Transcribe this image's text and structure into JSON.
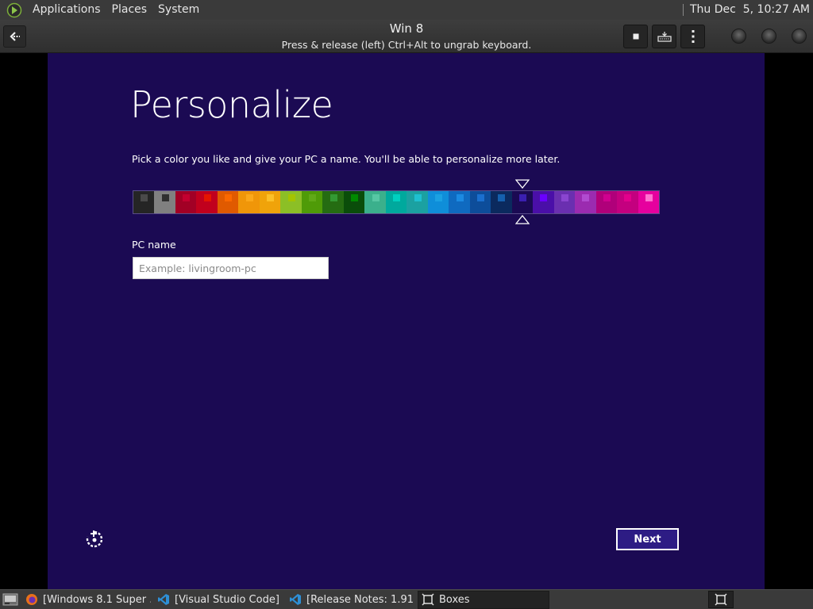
{
  "top_panel": {
    "menus": [
      "Applications",
      "Places",
      "System"
    ],
    "clock": "Thu Dec  5, 10:27 AM"
  },
  "header": {
    "title": "Win 8",
    "subtitle": "Press & release (left) Ctrl+Alt to ungrab keyboard."
  },
  "vm": {
    "title": "Personalize",
    "description": "Pick a color you like and give your PC a name. You'll be able to personalize more later.",
    "pc_name_label": "PC name",
    "pc_name_value": "",
    "pc_name_placeholder": "Example: livingroom-pc",
    "next_label": "Next",
    "selected_color_index": 18,
    "colors": [
      {
        "bg": "#252525",
        "chip": "#4a4a4a"
      },
      {
        "bg": "#808080",
        "chip": "#303030"
      },
      {
        "bg": "#a20025",
        "chip": "#c3002f"
      },
      {
        "bg": "#c1001d",
        "chip": "#e51400"
      },
      {
        "bg": "#e05a00",
        "chip": "#fa6800"
      },
      {
        "bg": "#f09609",
        "chip": "#fba81a"
      },
      {
        "bg": "#f0a30a",
        "chip": "#fcc028"
      },
      {
        "bg": "#8cbf26",
        "chip": "#a4c400"
      },
      {
        "bg": "#4f9b08",
        "chip": "#60a917"
      },
      {
        "bg": "#256c12",
        "chip": "#339933"
      },
      {
        "bg": "#0a4d0a",
        "chip": "#008a00"
      },
      {
        "bg": "#3bb08c",
        "chip": "#57c7a4"
      },
      {
        "bg": "#00a99d",
        "chip": "#00d0c0"
      },
      {
        "bg": "#1ba1a1",
        "chip": "#1ec0d0"
      },
      {
        "bg": "#0f8ed9",
        "chip": "#1ba1e2"
      },
      {
        "bg": "#0f6ac0",
        "chip": "#1b8ae2"
      },
      {
        "bg": "#0d4d9a",
        "chip": "#1a6fcf"
      },
      {
        "bg": "#0b2a5e",
        "chip": "#1560ad"
      },
      {
        "bg": "#1b0a53",
        "chip": "#3a1fb0"
      },
      {
        "bg": "#4a0fa8",
        "chip": "#6a00ff"
      },
      {
        "bg": "#6a2fb0",
        "chip": "#8a45d0"
      },
      {
        "bg": "#9b2bb0",
        "chip": "#b14bd0"
      },
      {
        "bg": "#b0007a",
        "chip": "#d0008f"
      },
      {
        "bg": "#c4007f",
        "chip": "#e3008c"
      },
      {
        "bg": "#e6009e",
        "chip": "#ff70d0"
      }
    ]
  },
  "taskbar": {
    "items": [
      {
        "label": "[Windows 8.1 Super ...",
        "icon": "firefox-icon",
        "icon_color": "#e8701a",
        "active": false
      },
      {
        "label": "[Visual Studio Code]",
        "icon": "vscode-icon",
        "icon_color": "#2e8fd6",
        "active": false
      },
      {
        "label": "[Release Notes: 1.91...",
        "icon": "vscode-icon",
        "icon_color": "#2e8fd6",
        "active": false
      },
      {
        "label": "Boxes",
        "icon": "boxes-icon",
        "icon_color": "#d8d8d8",
        "active": true
      }
    ]
  }
}
